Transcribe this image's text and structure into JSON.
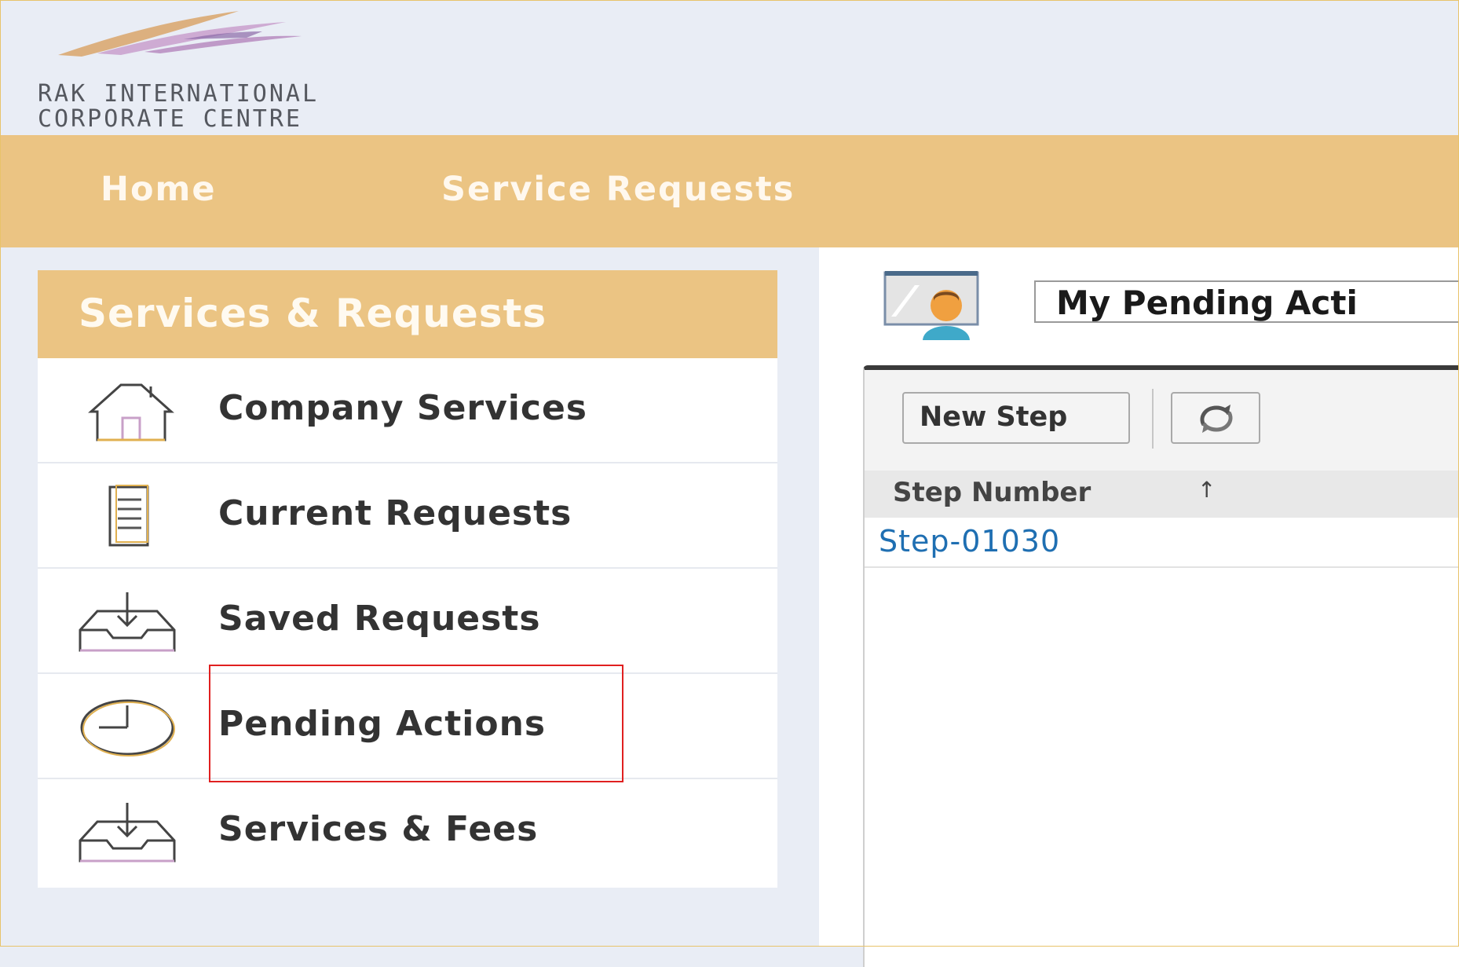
{
  "header": {
    "logo_line1": "RAK INTERNATIONAL",
    "logo_line2": "CORPORATE CENTRE"
  },
  "nav": {
    "items": [
      {
        "label": "Home"
      },
      {
        "label": "Service Requests"
      }
    ]
  },
  "sidebar": {
    "title": "Services & Requests",
    "items": [
      {
        "label": "Company Services",
        "icon": "house-icon"
      },
      {
        "label": "Current Requests",
        "icon": "clipboard-icon"
      },
      {
        "label": "Saved Requests",
        "icon": "inbox-download-icon"
      },
      {
        "label": "Pending Actions",
        "icon": "clock-icon",
        "highlighted": true
      },
      {
        "label": "Services & Fees",
        "icon": "inbox-download-icon"
      }
    ]
  },
  "main": {
    "view_selected": "My Pending Acti",
    "toolbar": {
      "new_step_label": "New Step"
    },
    "table": {
      "columns": [
        {
          "label": "Step Number",
          "sort": "ascending"
        }
      ],
      "sort_glyph": "↑",
      "rows": [
        {
          "step_number": "Step-01030"
        }
      ]
    }
  },
  "colors": {
    "accent": "#ebc483",
    "background": "#e9edf5",
    "link": "#1f6fb2",
    "highlight_border": "#e02020"
  }
}
